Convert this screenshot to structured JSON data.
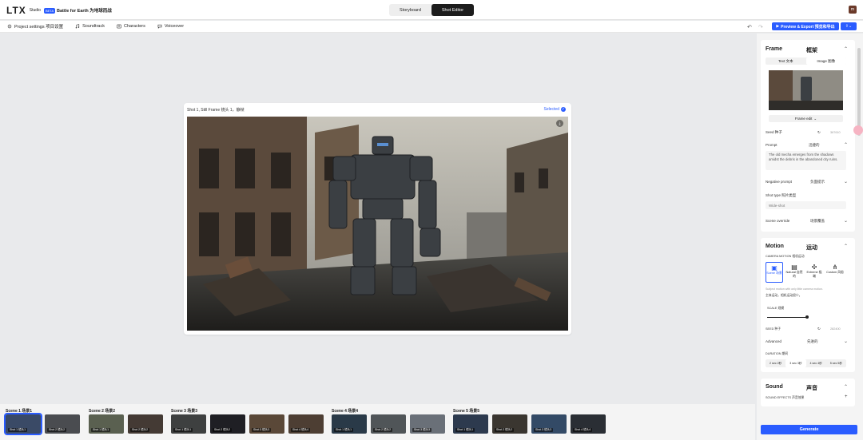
{
  "app": {
    "logo": "LTX",
    "studio": "Studio",
    "beta": "BETA",
    "project_title": "Battle for Earth 为地球而战",
    "avatar": "m"
  },
  "tabs": {
    "storyboard": "Storyboard",
    "shot_editor": "Shot Editor"
  },
  "toolbar": {
    "project_settings": "Project settings 项目设置",
    "soundtrack": "Soundtrack",
    "characters": "Characters",
    "voiceover": "Voiceover"
  },
  "actions": {
    "export": "Preview & Export 预览和导出",
    "share": "⌄"
  },
  "canvas": {
    "title": "Shot 1, Still Frame 镜头 1，静帧",
    "selected": "Selected"
  },
  "panel": {
    "frame": {
      "title": "Frame",
      "title_cn": "框架",
      "text_tab": "Text 文本",
      "image_tab": "Image 图像",
      "frame_edit": "Frame edit",
      "seed_label": "Seed 种子",
      "seed_value": "367610",
      "prompt_label": "Prompt",
      "prompt_cn": "迅捷的",
      "prompt_text": "The old mecha emerges from the shadows amidst the debris in the abandoned city ruins.",
      "neg_label": "Negative prompt",
      "neg_cn": "负面提示",
      "shot_type_label": "Shot type 照片类型",
      "shot_type_value": "Wide-shot",
      "scene_override_label": "Scene override",
      "scene_override_cn": "场景覆盖"
    },
    "motion": {
      "title": "Motion",
      "title_cn": "运动",
      "camera_label": "CAMERA MOTION 相机运动",
      "options": [
        "Scene 场景",
        "Natural 自然的",
        "Extreme 极端",
        "Custom 风俗"
      ],
      "hint": "Subject motion with only little camera motion.",
      "hint_cn": "主体运动，相机运动很少。",
      "scale_label": "SCALE 规模",
      "seed_label": "SEED 种子",
      "seed_value": "282400",
      "advanced_label": "Advanced",
      "advanced_cn": "先进的",
      "duration_label": "DURATION 期间",
      "durations": [
        "2 sec 2秒",
        "3 sec 3秒",
        "4 sec 4秒",
        "5 sec 5秒"
      ]
    },
    "sound": {
      "title": "Sound",
      "title_cn": "声音",
      "effects_label": "SOUND EFFECTS 声音效果"
    },
    "generate": "Generate"
  },
  "timeline": {
    "scenes": [
      {
        "label": "Scene 1 场景1",
        "shots": [
          "Shot 1 镜头1",
          "Shot 2 镜头2"
        ]
      },
      {
        "label": "Scene 2 场景2",
        "shots": [
          "Shot 1 镜头1",
          "Shot 2 镜头2"
        ]
      },
      {
        "label": "Scene 3 场景3",
        "shots": [
          "Shot 1 镜头1",
          "Shot 2 镜头2",
          "Shot 3 镜头3",
          "Shot 4 镜头4"
        ]
      },
      {
        "label": "Scene 4 场景4",
        "shots": [
          "Shot 1 镜头1",
          "Shot 2 镜头2",
          "Shot 3 镜头3"
        ]
      },
      {
        "label": "Scene 5 场景5",
        "shots": [
          "Shot 1 镜头1",
          "Shot 2 镜头2",
          "Shot 3 镜头3",
          "Shot 4 镜头4"
        ]
      }
    ]
  },
  "colors": {
    "accent": "#2a5cff",
    "dark": "#1c1c1c"
  }
}
